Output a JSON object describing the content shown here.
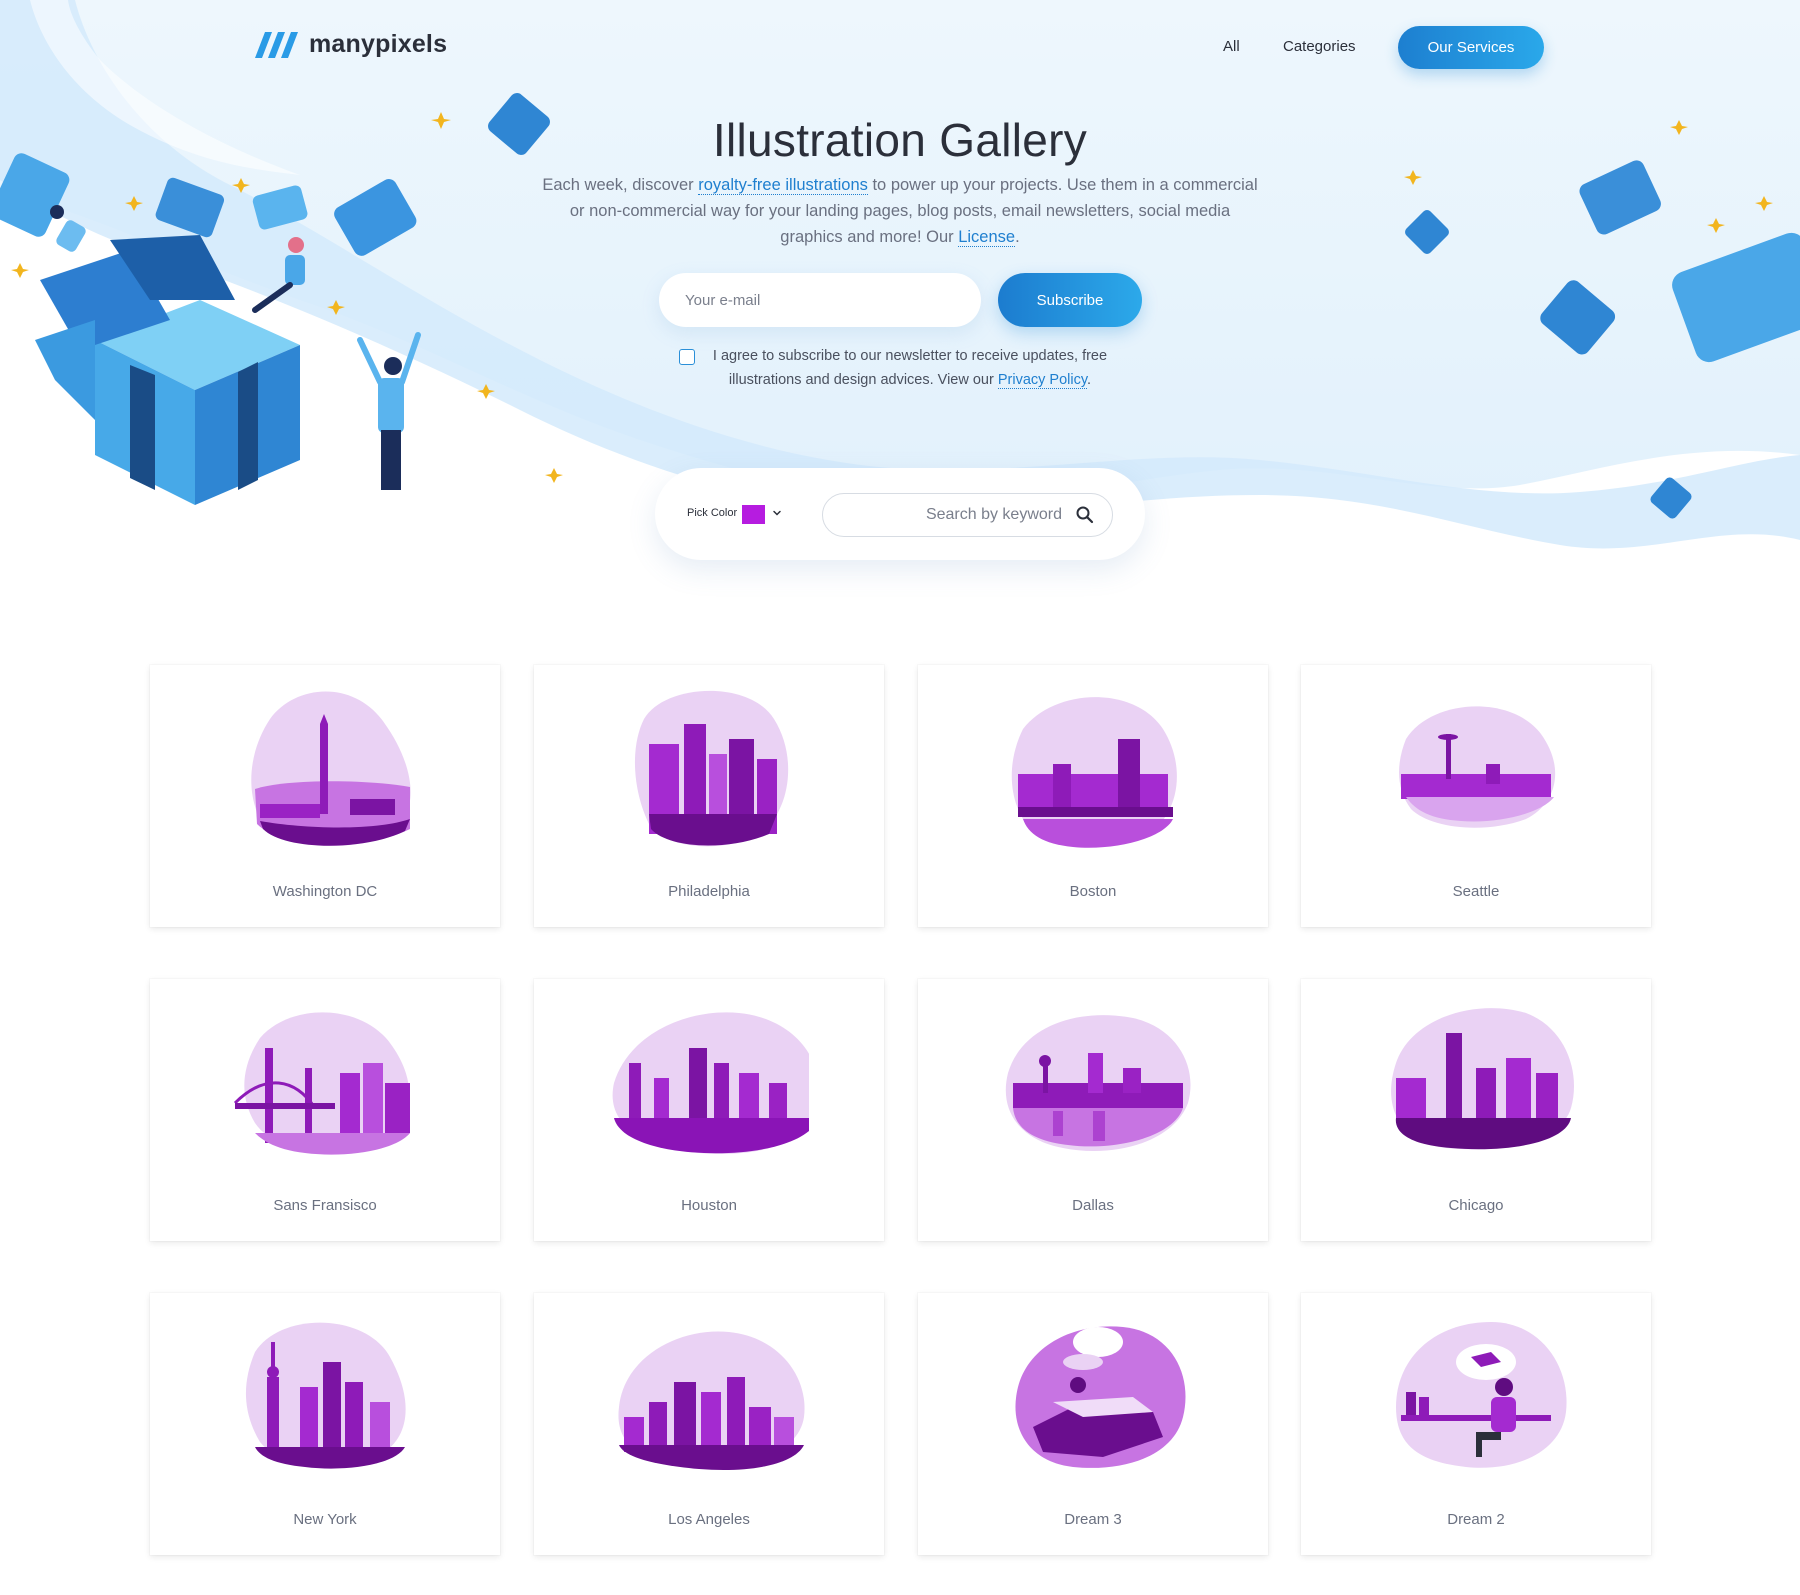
{
  "brand": {
    "name": "manypixels",
    "accent": "#1f87d6",
    "art_color": "#b61ce0"
  },
  "nav": {
    "links": [
      {
        "label": "All"
      },
      {
        "label": "Categories"
      }
    ],
    "services_label": "Our Services"
  },
  "hero": {
    "title": "Illustration Gallery",
    "desc_part1": "Each week, discover ",
    "desc_link1": "royalty-free illustrations",
    "desc_part2": " to power up your projects. Use them in a commercial or non-commercial way for your landing pages, blog posts, email newsletters, social media graphics and more! Our ",
    "desc_link2": "License",
    "desc_part3": ".",
    "email_placeholder": "Your e-mail",
    "subscribe_label": "Subscribe",
    "agree_text": "I agree to subscribe to our newsletter to receive updates, free illustrations and design advices. View our ",
    "privacy_link": "Privacy Policy",
    "agree_end": "."
  },
  "filters": {
    "pick_color_label": "Pick Color",
    "search_placeholder": "Search by keyword"
  },
  "gallery": {
    "items": [
      {
        "title": "Washington DC"
      },
      {
        "title": "Philadelphia"
      },
      {
        "title": "Boston"
      },
      {
        "title": "Seattle"
      },
      {
        "title": "Sans Fransisco"
      },
      {
        "title": "Houston"
      },
      {
        "title": "Dallas"
      },
      {
        "title": "Chicago"
      },
      {
        "title": "New York"
      },
      {
        "title": "Los Angeles"
      },
      {
        "title": "Dream 3"
      },
      {
        "title": "Dream 2"
      }
    ]
  }
}
